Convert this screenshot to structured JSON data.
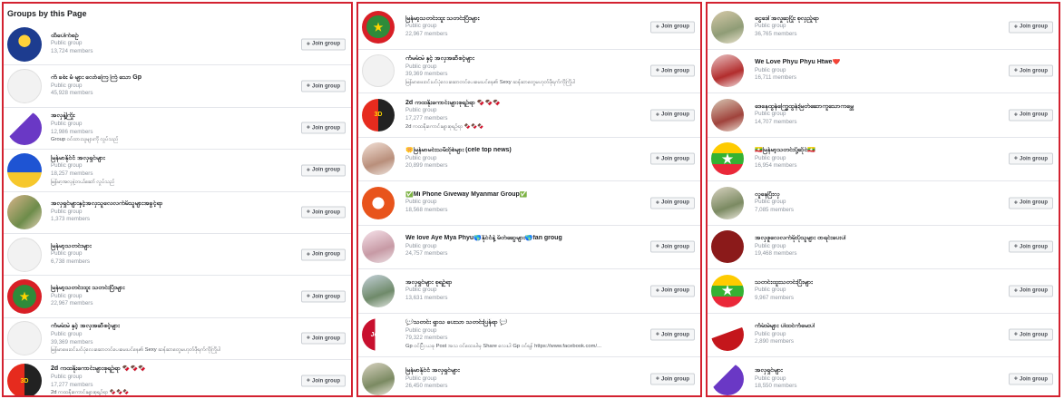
{
  "panel1": {
    "title": "Groups by this Page",
    "groups": [
      {
        "name": "ထီပေါက်စဉ်",
        "type": "Public group",
        "members": "13,724 members",
        "desc": "",
        "avatar": "av-blue"
      },
      {
        "name": "ကိ ခစ်း မံ များ လော်ကြေ ကြဲ သော Gp",
        "type": "Public group",
        "members": "45,928 members",
        "desc": "",
        "avatar": "av-white"
      },
      {
        "name": "အလှနဲ့ကြိုး",
        "type": "Public group",
        "members": "12,986 members",
        "desc": "Group ဝင်ထားသူများကို လှုပ်သည်",
        "avatar": "av-purple"
      },
      {
        "name": "မြန်မာနိုင်ငံ အလှရှင်များ",
        "type": "Public group",
        "members": "18,257 members",
        "desc": "မြန်မာ့အလှနဲ့တယ်ဆော် လှုပ်သည်",
        "avatar": "av-flag-b"
      },
      {
        "name": "အလှရှင်များနှင့်အလှသူလေလက်မိသူများအခွင့်ရာ",
        "type": "Public group",
        "members": "1,373 members",
        "desc": "",
        "avatar": "av-photo1"
      },
      {
        "name": "မြန်မာ့သတင်းများ",
        "type": "Public group",
        "members": "6,738 members",
        "desc": "",
        "avatar": "av-white"
      },
      {
        "name": "မြန်မာ့သတင်းထူး သတင်းပြီးများ",
        "type": "Public group",
        "members": "22,967 members",
        "desc": "",
        "avatar": "av-mmstar"
      },
      {
        "name": "ကံမမ်းမဲ နှင့် အလှအဆီစင့်များ",
        "type": "Public group",
        "members": "39,369 members",
        "desc": "မြန်မာဖေးဝင်းပင်ပုံလေးဆောတင်ပေးမေးပင်နေ၏ Sexy ဆန်ဆာတွေမဟုတ်ဖိုရက်ကိုကြိုပါ",
        "avatar": "av-white"
      },
      {
        "name": "2d ကထနိုးကောင်းများ‌စုရဉ်ရာ 🍫🍫🍫",
        "type": "Public group",
        "members": "17,277 members",
        "desc": "2d ကထနိုးကောင်းများ‌စုရဉ်ရာ 🍫🍫🍫",
        "avatar": "av-red3d"
      }
    ]
  },
  "panel2": {
    "groups": [
      {
        "name": "မြန်မာ့သတင်းထူး သတင်းပြီးများ",
        "type": "Public group",
        "members": "22,967 members",
        "desc": "",
        "avatar": "av-mmstar"
      },
      {
        "name": "ကံမမ်းမဲ နှင့် အလှအဆီစင့်များ",
        "type": "Public group",
        "members": "39,369 members",
        "desc": "မြန်မာဖေးဝင်းပင်ပုံလေးဆောတင်ပေးမေးပင်နေ၏ Sexy ဆန်ဆာတွေမဟုတ်ဖိုရက်ကိုကြိုပါ",
        "avatar": "av-white"
      },
      {
        "name": "2d ကထနိုးကောင်းများ‌စုရဉ်ရာ 🍫🍫🍫",
        "type": "Public group",
        "members": "17,277 members",
        "desc": "2d ကထနိုးကောင်းများ‌စုရဉ်ရာ 🍫🍫🍫",
        "avatar": "av-red3d"
      },
      {
        "name": "🌼မြန်မာမင်းသမီးဝိုစ်များ (cele top news)",
        "type": "Public group",
        "members": "20,899 members",
        "desc": "",
        "avatar": "av-girl"
      },
      {
        "name": "✅Mi Phone Giveway Myanmar Group✅",
        "type": "Public group",
        "members": "18,568 members",
        "desc": "",
        "avatar": "av-orange"
      },
      {
        "name": "We love Aye Mya Phyu🌎နိုင်ငံနဲ့ မိတ်ဆွေများ🌎fan groug",
        "type": "Public group",
        "members": "24,757 members",
        "desc": "",
        "avatar": "av-pink"
      },
      {
        "name": "အလှရှင်များ စုရဉ်ရာ",
        "type": "Public group",
        "members": "13,631 members",
        "desc": "",
        "avatar": "av-hall"
      },
      {
        "name": "💬သတင်း ရှာသ ပေးသာ သတင်းပြန်ရာ 💬",
        "type": "Public group",
        "members": "79,322 members",
        "desc": "Gp ဝင်ပြီး ယခု Post အသ ဝင်ထေးပါမှ Share လေးပါ Gp ဝင်ရန် https://www.facebook.com/...",
        "avatar": "av-join"
      },
      {
        "name": "မြန်မာနိုင်ငံ အလှရှင်များ",
        "type": "Public group",
        "members": "26,450 members",
        "desc": "",
        "avatar": "av-hut"
      }
    ]
  },
  "panel3": {
    "groups": [
      {
        "name": "ငွေဒေါ်အလှုဆုပြိုး စုလှည့်ရာ",
        "type": "Public group",
        "members": "36,765 members",
        "desc": "",
        "avatar": "av-money"
      },
      {
        "name": "We Love Phyu Phyu Htwe❤️",
        "type": "Public group",
        "members": "16,711 members",
        "desc": "",
        "avatar": "av-red1"
      },
      {
        "name": "ဒေနေထွန်ကြွှေထွန်းမြတ်ဆောကူသောကမ္ဘေ",
        "type": "Public group",
        "members": "14,707 members",
        "desc": "",
        "avatar": "av-crowd"
      },
      {
        "name": "🇲🇲မြန်မာ့သတင်းပို့ဆိုင်🇲🇲",
        "type": "Public group",
        "members": "16,954 members",
        "desc": "",
        "avatar": "av-mmflag"
      },
      {
        "name": "လူနေပြီးလှ",
        "type": "Public group",
        "members": "7,085 members",
        "desc": "",
        "avatar": "av-hut"
      },
      {
        "name": "အလှဖူလေလက်မိုးပိုသူများ ဝာရင်းပေးပါ",
        "type": "Public group",
        "members": "19,468 members",
        "desc": "",
        "avatar": "av-maroon"
      },
      {
        "name": "သတင်းထူးသတင်းပြီးများ",
        "type": "Public group",
        "members": "9,967 members",
        "desc": "",
        "avatar": "av-mmflag"
      },
      {
        "name": "ကံမ်းမဲများ ပါထင်ကံမေးပါ",
        "type": "Public group",
        "members": "2,890 members",
        "desc": "",
        "avatar": "av-moto"
      },
      {
        "name": "အလှရှင်များ",
        "type": "Public group",
        "members": "18,550 members",
        "desc": "",
        "avatar": "av-purple"
      }
    ]
  },
  "join_label": "Join group",
  "join_icon": "+"
}
